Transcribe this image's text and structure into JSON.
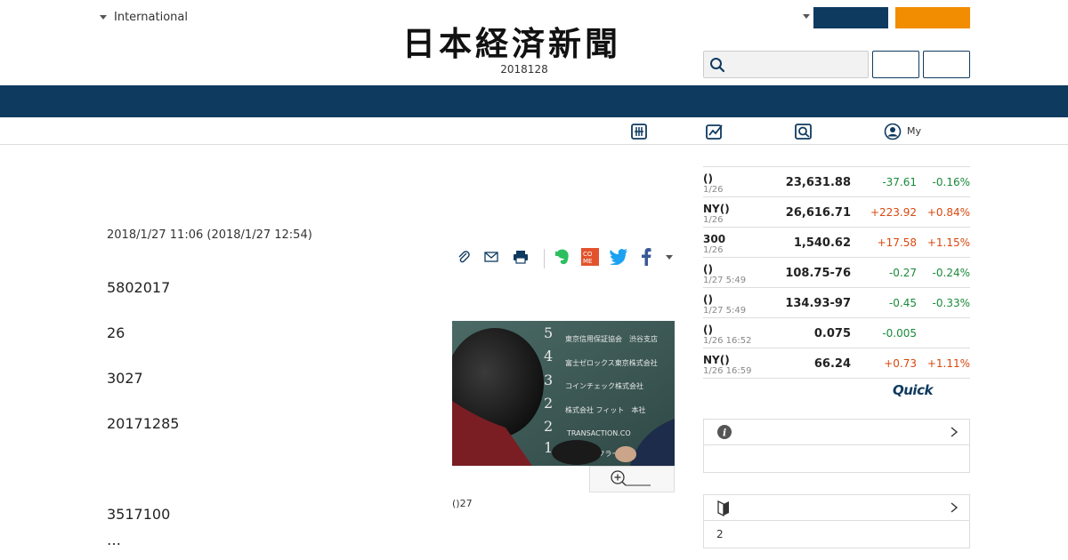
{
  "header": {
    "edition_label": "International",
    "logo_text": "日本経済新聞",
    "date": "2018128",
    "search_placeholder": ""
  },
  "subnav": [
    {
      "icon": "grid-icon",
      "label": ""
    },
    {
      "icon": "chart-icon",
      "label": ""
    },
    {
      "icon": "search-doc-icon",
      "label": ""
    },
    {
      "icon": "user-icon",
      "label": "My"
    }
  ],
  "article": {
    "date": "2018/1/27 11:06 (2018/1/27 12:54)",
    "paragraphs": [
      "5802017",
      "26",
      "3027",
      "20171285",
      "3517100",
      "…"
    ],
    "photo_caption": "()27",
    "photo_signs": [
      {
        "num": "5",
        "text": "東京信用保証協会　渋谷支店"
      },
      {
        "num": "4",
        "text": "富士ゼロックス東京株式会社"
      },
      {
        "num": "3",
        "text": "コインチェック株式会社"
      },
      {
        "num": "2",
        "text": "株式会社 フィット　本社"
      },
      {
        "num": "2",
        "text": "TRANSACTION.CO"
      },
      {
        "num": "1",
        "text": "株式会社 クラー"
      }
    ]
  },
  "market": {
    "rows": [
      {
        "name": "()",
        "time": "1/26",
        "value": "23,631.88",
        "change": "-37.61",
        "pct": "-0.16%",
        "dir": "down"
      },
      {
        "name": "NY()",
        "time": "1/26",
        "value": "26,616.71",
        "change": "+223.92",
        "pct": "+0.84%",
        "dir": "up"
      },
      {
        "name": "300",
        "time": "1/26",
        "value": "1,540.62",
        "change": "+17.58",
        "pct": "+1.15%",
        "dir": "up"
      },
      {
        "name": "()",
        "time": "1/27 5:49",
        "value": "108.75-76",
        "change": "-0.27",
        "pct": "-0.24%",
        "dir": "down"
      },
      {
        "name": "()",
        "time": "1/27 5:49",
        "value": "134.93-97",
        "change": "-0.45",
        "pct": "-0.33%",
        "dir": "down"
      },
      {
        "name": "()",
        "time": "1/26 16:52",
        "value": "0.075",
        "change": "-0.005",
        "pct": "",
        "dir": "down"
      },
      {
        "name": "NY()",
        "time": "1/26 16:59",
        "value": "66.24",
        "change": "+0.73",
        "pct": "+1.11%",
        "dir": "up"
      }
    ],
    "quick_label": "Quick"
  },
  "panels": [
    {
      "icon": "info-icon",
      "body": ""
    },
    {
      "icon": "beginner-icon",
      "body": "2"
    }
  ],
  "colors": {
    "navy": "#0f3a5f",
    "orange": "#f28c00",
    "up": "#d9480f",
    "down": "#1a8a3a"
  }
}
